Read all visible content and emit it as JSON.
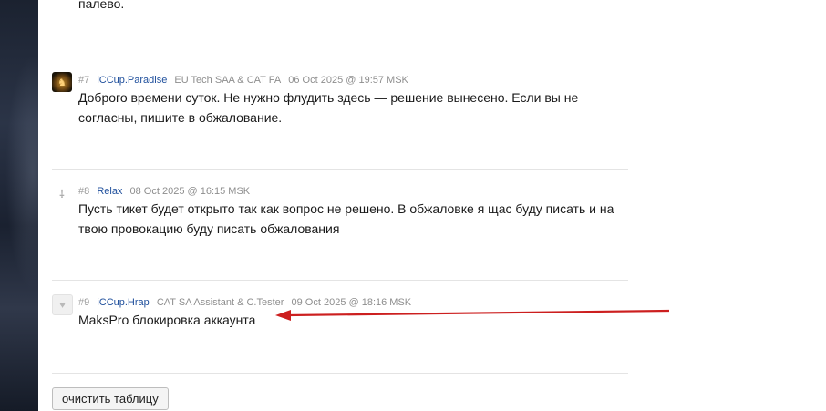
{
  "previous_text": "палево.",
  "posts": [
    {
      "number": "#7",
      "user": "iCCup.Paradise",
      "role": "EU Tech SAA & CAT FA",
      "date": "06 Oct 2025 @ 19:57 MSK",
      "avatar_icon": "paradise-avatar-icon",
      "text": "Доброго времени суток. Не нужно флудить здесь — решение вынесено. Если вы не согласны, пишите в обжалование."
    },
    {
      "number": "#8",
      "user": "Relax",
      "role": "",
      "date": "08 Oct 2025 @ 16:15 MSK",
      "avatar_icon": "relax-avatar-icon",
      "text": "Пусть тикет будет открыто так как вопрос не решено. В обжаловке я щас буду писать и на твою провокацию буду писать обжалования"
    },
    {
      "number": "#9",
      "user": "iCCup.Hrap",
      "role": "CAT SA Assistant & C.Tester",
      "date": "09 Oct 2025 @ 18:16 MSK",
      "avatar_icon": "hrap-avatar-icon",
      "text": "MaksPro блокировка аккаунта"
    }
  ],
  "clear_button_label": "очистить таблицу",
  "annotation": {
    "arrow_color": "#cc1f1f"
  }
}
